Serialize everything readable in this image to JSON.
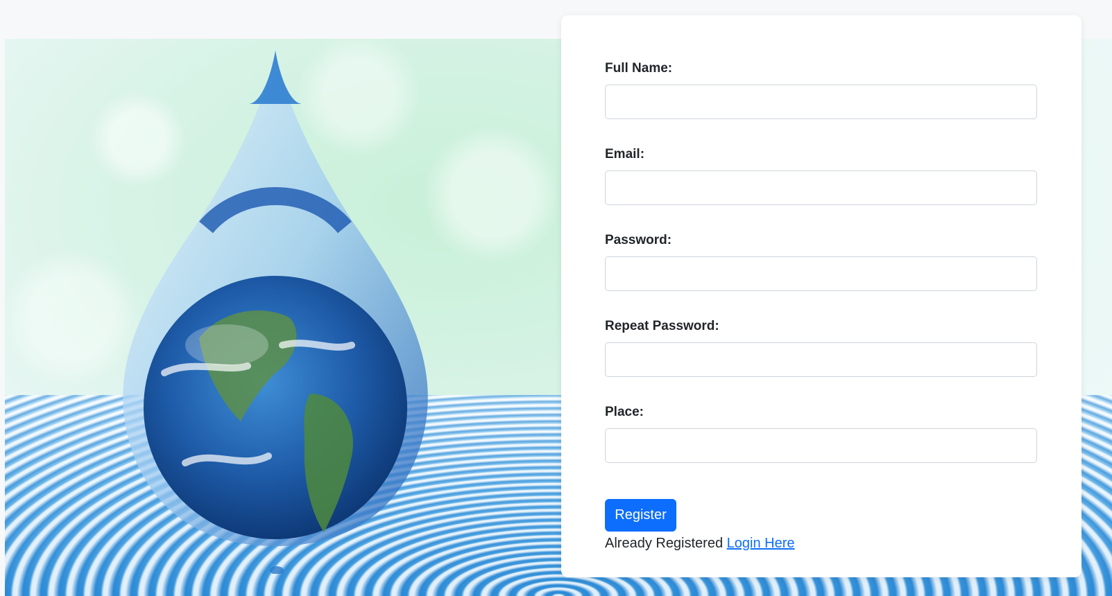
{
  "form": {
    "fields": [
      {
        "label": "Full Name:",
        "value": "",
        "placeholder": ""
      },
      {
        "label": "Email:",
        "value": "",
        "placeholder": ""
      },
      {
        "label": "Password:",
        "value": "",
        "placeholder": ""
      },
      {
        "label": "Repeat Password:",
        "value": "",
        "placeholder": ""
      },
      {
        "label": "Place:",
        "value": "",
        "placeholder": ""
      }
    ],
    "submit_label": "Register",
    "already_text": "Already Registered",
    "login_link": "Login Here"
  },
  "colors": {
    "primary": "#0d6efd",
    "label": "#212529",
    "input_border": "#ced4da"
  },
  "hero": {
    "image": "water-drop-with-earth-illustration"
  }
}
